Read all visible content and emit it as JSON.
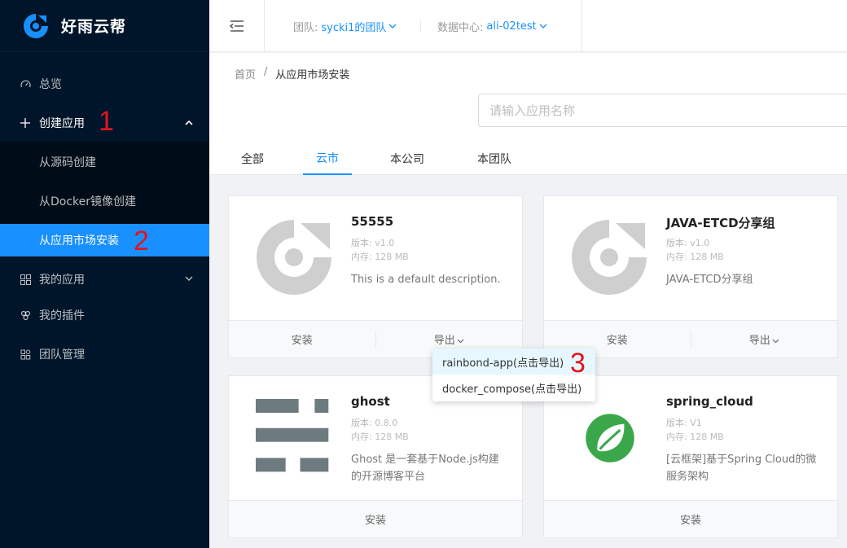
{
  "app": {
    "name": "好雨云帮"
  },
  "sidebar": {
    "items": [
      {
        "label": "总览",
        "icon": "dashboard-icon"
      },
      {
        "label": "创建应用",
        "icon": "plus-icon"
      },
      {
        "label": "我的应用",
        "icon": "appstore-icon"
      },
      {
        "label": "我的插件",
        "icon": "plugin-icon"
      },
      {
        "label": "团队管理",
        "icon": "team-icon"
      }
    ],
    "submenu": [
      {
        "label": "从源码创建"
      },
      {
        "label": "从Docker镜像创建"
      },
      {
        "label": "从应用市场安装"
      }
    ]
  },
  "annotations": {
    "one": "1",
    "two": "2",
    "three": "3"
  },
  "header": {
    "team_label": "团队:",
    "team_value": "sycki1的团队",
    "dc_label": "数据中心:",
    "dc_value": "ali-02test"
  },
  "breadcrumb": {
    "home": "首页",
    "sep": "/",
    "current": "从应用市场安装"
  },
  "search": {
    "placeholder": "请输入应用名称"
  },
  "tabs": [
    {
      "label": "全部"
    },
    {
      "label": "云市"
    },
    {
      "label": "本公司"
    },
    {
      "label": "本团队"
    }
  ],
  "cards": [
    {
      "title": "55555",
      "version": "版本: v1.0",
      "memory": "内存: 128 MB",
      "desc": "This is a default description.",
      "install": "安装",
      "export": "导出"
    },
    {
      "title": "JAVA-ETCD分享组",
      "version": "版本: v1.0",
      "memory": "内存: 128 MB",
      "desc": "JAVA-ETCD分享组",
      "install": "安装",
      "export": "导出"
    },
    {
      "title": "ghost",
      "version": "版本: 0.8.0",
      "memory": "内存: 128 MB",
      "desc": "Ghost 是一套基于Node.js构建的开源博客平台",
      "install": "安装"
    },
    {
      "title": "spring_cloud",
      "version": "版本: V1",
      "memory": "内存: 128 MB",
      "desc": "[云框架]基于Spring Cloud的微服务架构",
      "install": "安装"
    }
  ],
  "dropdown": {
    "items": [
      {
        "label": "rainbond-app(点击导出)"
      },
      {
        "label": "docker_compose(点击导出)"
      }
    ]
  },
  "colors": {
    "primary": "#1890ff",
    "sidebar": "#001529",
    "annotation": "#e3141e",
    "spring": "#3aa84a"
  }
}
